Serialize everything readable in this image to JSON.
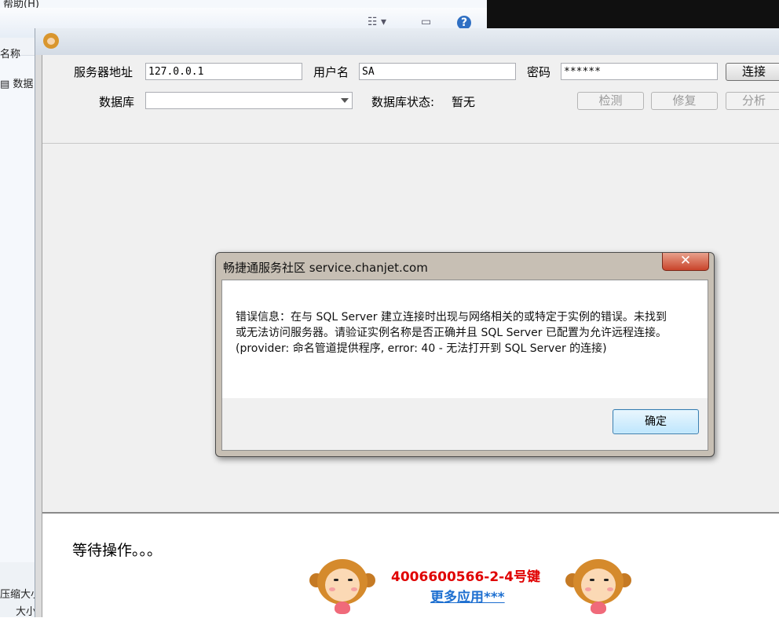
{
  "background_window": {
    "menu_text": "帮助(H)",
    "column_name_partial": "名称",
    "list_item_partial": "数据",
    "status_compress_partial": "压缩大小",
    "status_size_partial": "大小"
  },
  "form": {
    "server_label": "服务器地址",
    "server_value": "127.0.0.1",
    "user_label": "用户名",
    "user_value": "SA",
    "password_label": "密码",
    "password_value": "******",
    "connect_button": "连接",
    "database_label": "数据库",
    "database_value": "",
    "db_status_label": "数据库状态:",
    "db_status_value": "暂无",
    "check_button": "检测",
    "repair_button": "修复",
    "analyze_button": "分析"
  },
  "status": {
    "text": "等待操作。。。"
  },
  "footer": {
    "hotline": "4006600566-2-4号键",
    "more_apps": "更多应用***"
  },
  "dialog": {
    "title": "畅捷通服务社区 service.chanjet.com",
    "close_symbol": "✕",
    "message": "错误信息：在与 SQL Server 建立连接时出现与网络相关的或特定于实例的错误。未找到或无法访问服务器。请验证实例名称是否正确并且 SQL Server 已配置为允许远程连接。 (provider: 命名管道提供程序, error: 40 - 无法打开到 SQL Server 的连接)",
    "ok_button": "确定"
  },
  "colors": {
    "hotline": "#e00000",
    "link": "#1d6fd0",
    "dialog_close": "#c9442b"
  }
}
